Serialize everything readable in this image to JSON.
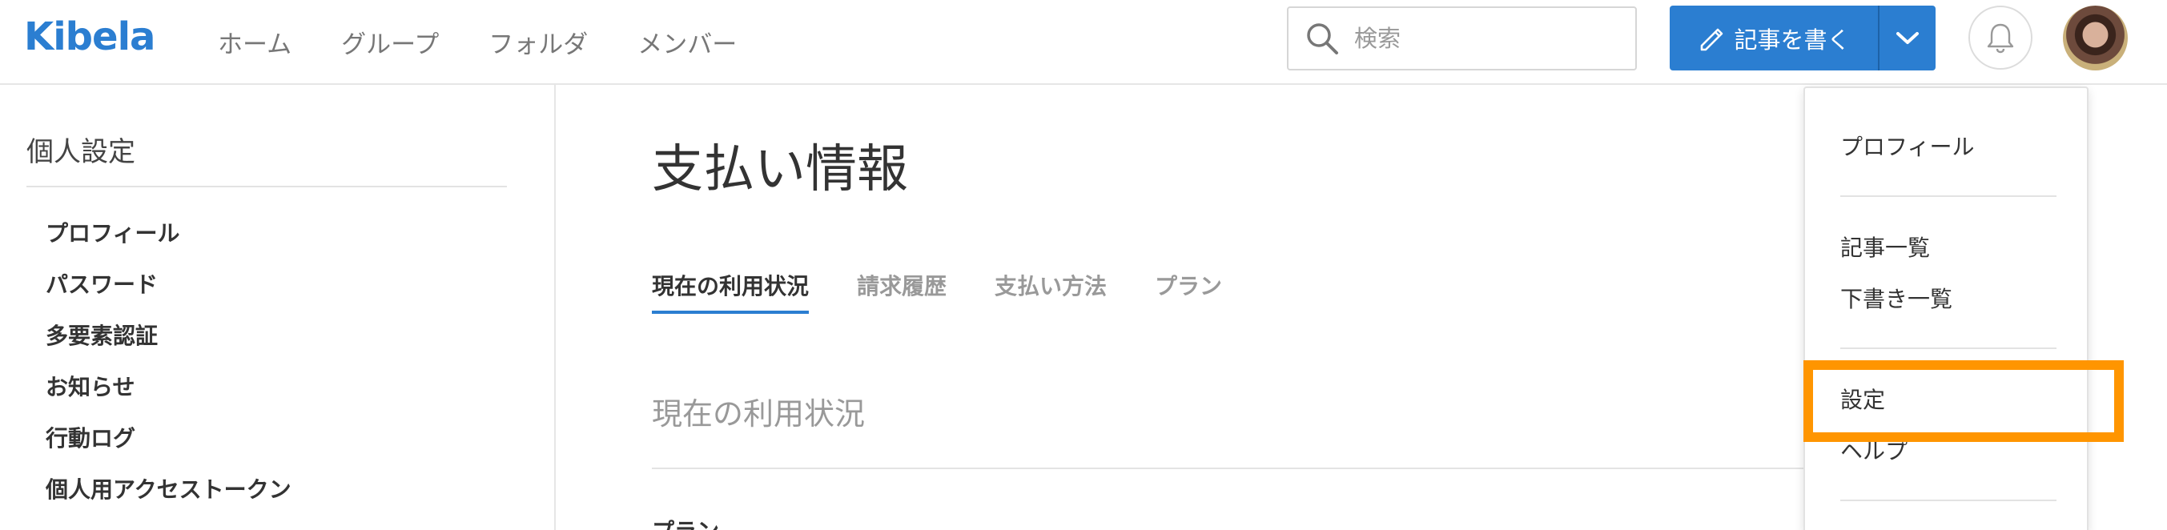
{
  "header": {
    "logo": "Kibela",
    "nav": [
      "ホーム",
      "グループ",
      "フォルダ",
      "メンバー"
    ],
    "search_placeholder": "検索",
    "write_label": "記事を書く"
  },
  "sidebar": {
    "title": "個人設定",
    "items": [
      "プロフィール",
      "パスワード",
      "多要素認証",
      "お知らせ",
      "行動ログ",
      "個人用アクセストークン"
    ]
  },
  "main": {
    "title": "支払い情報",
    "tabs": [
      "現在の利用状況",
      "請求履歴",
      "支払い方法",
      "プラン"
    ],
    "active_tab": 0,
    "section_title": "現在の利用状況",
    "sub_label": "プラン"
  },
  "dropdown": {
    "items": [
      "プロフィール",
      "記事一覧",
      "下書き一覧",
      "設定",
      "ヘルプ"
    ],
    "highlighted": "設定"
  },
  "colors": {
    "accent": "#2b7ed1",
    "highlight": "#ff9500"
  }
}
